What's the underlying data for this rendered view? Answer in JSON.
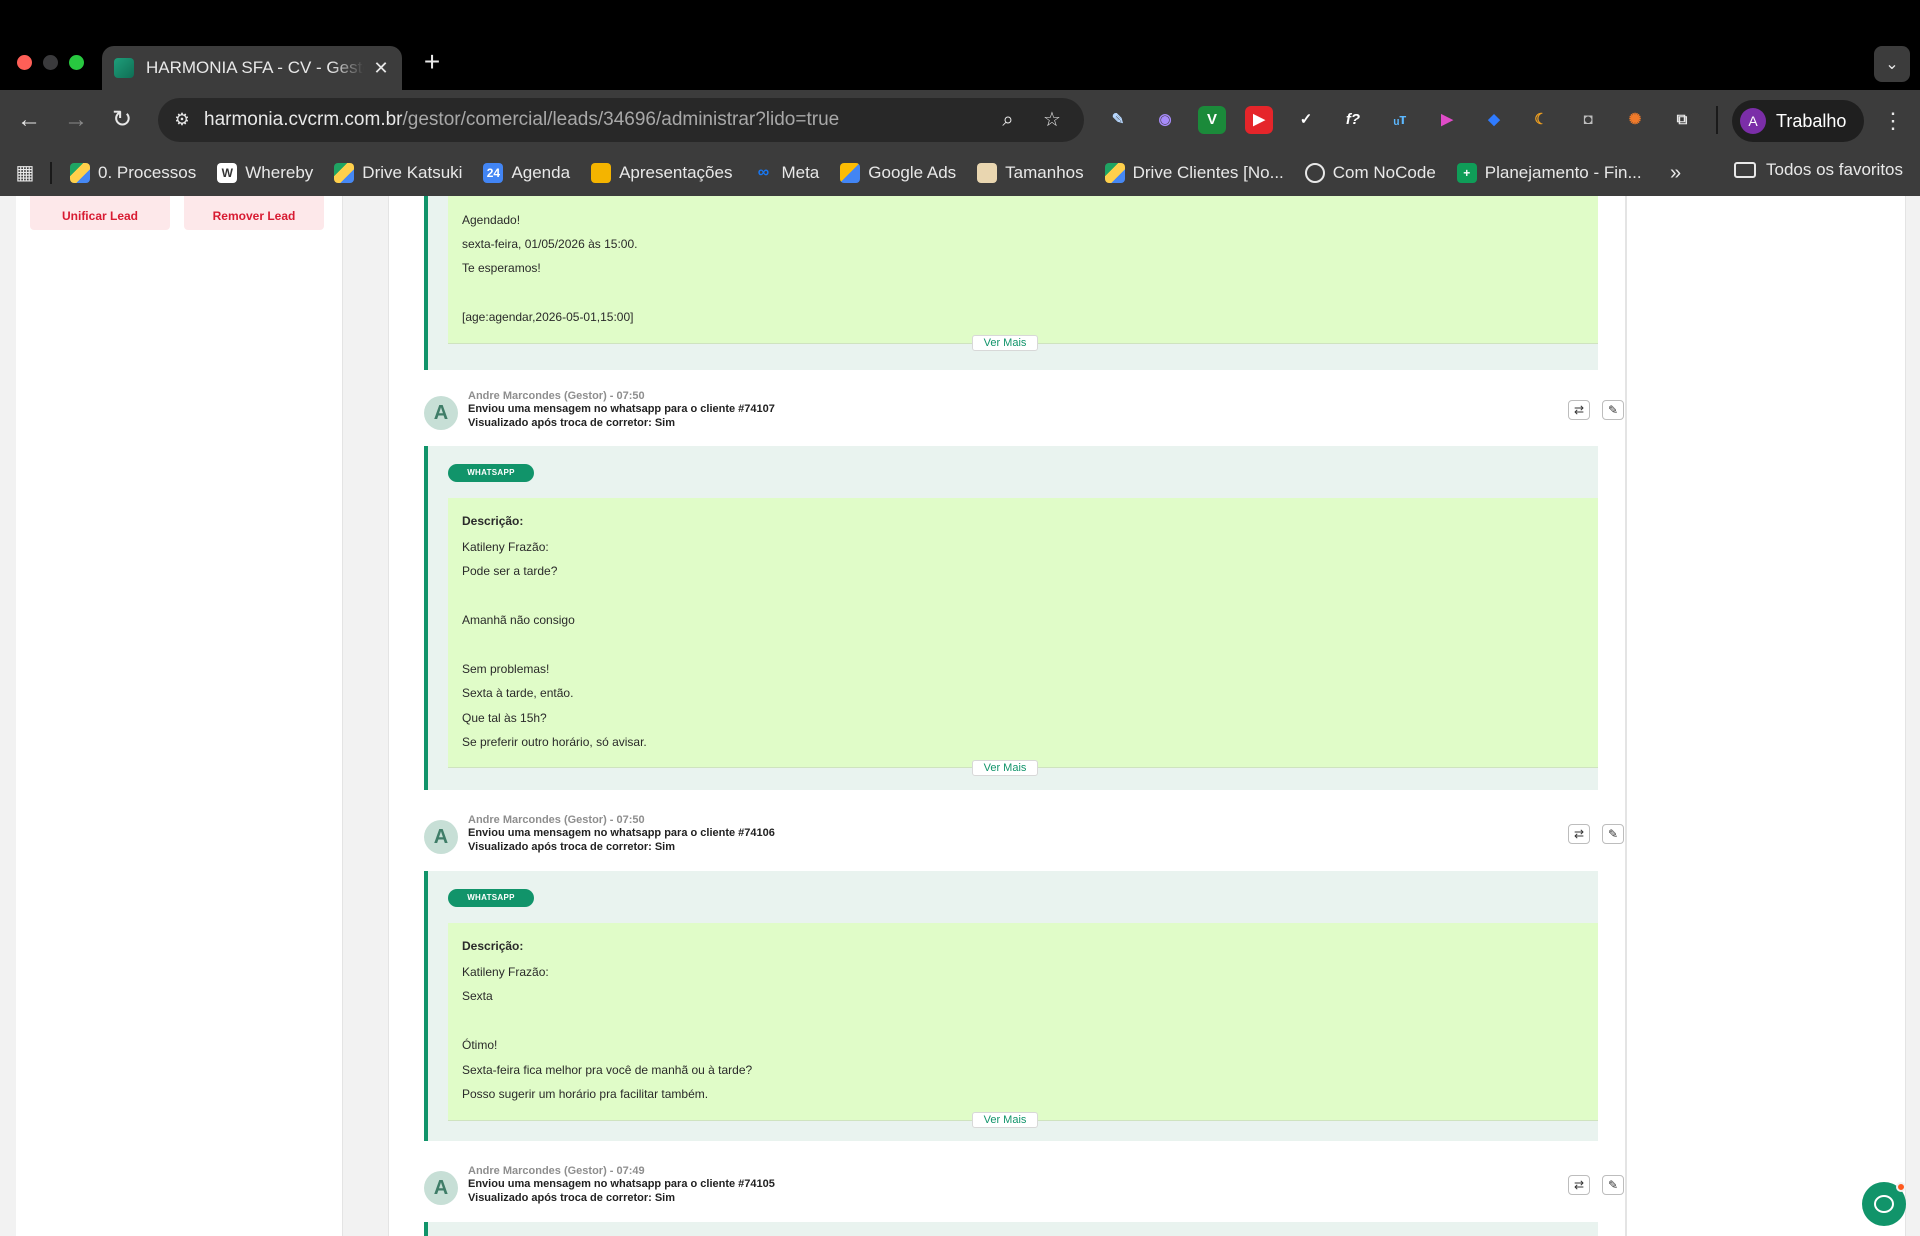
{
  "browser": {
    "tab_title": "HARMONIA SFA - CV - Gestor",
    "url_domain": "harmonia.cvcrm.com.br",
    "url_path": "/gestor/comercial/leads/34696/administrar?lido=true",
    "profile_initial": "A",
    "profile_name": "Trabalho",
    "bookmarks": [
      {
        "label": "0. Processos",
        "icon": "drive-icon"
      },
      {
        "label": "Whereby",
        "icon": "whereby-icon"
      },
      {
        "label": "Drive Katsuki",
        "icon": "drive-icon"
      },
      {
        "label": "Agenda",
        "icon": "calendar-icon"
      },
      {
        "label": "Apresentações",
        "icon": "slides-icon"
      },
      {
        "label": "Meta",
        "icon": "meta-icon"
      },
      {
        "label": "Google Ads",
        "icon": "google-ads-icon"
      },
      {
        "label": "Tamanhos",
        "icon": "tamanhos-icon"
      },
      {
        "label": "Drive Clientes [No...",
        "icon": "drive-icon"
      },
      {
        "label": "Com NoCode",
        "icon": "nocode-icon"
      },
      {
        "label": "Planejamento - Fin...",
        "icon": "sheets-icon"
      }
    ],
    "all_bookmarks": "Todos os favoritos"
  },
  "left_panel": {
    "unificar_label": "Unificar Lead",
    "remover_label": "Remover Lead"
  },
  "timeline": {
    "first_block": {
      "lines": [
        "Agendado!",
        "sexta-feira, 01/05/2026 às 15:00.",
        "Te esperamos!",
        "",
        "[age:agendar,2026-05-01,15:00]"
      ],
      "ver_mais": "Ver Mais"
    },
    "entries": [
      {
        "author": "Andre Marcondes (Gestor) - 07:50",
        "action": "Enviou uma mensagem no whatsapp para o cliente #74107",
        "viewed": "Visualizado após troca de corretor:  Sim",
        "badge": "WHATSAPP",
        "desc_label": "Descrição:",
        "lines": [
          "Katileny Frazão:",
          "Pode ser a tarde?",
          "",
          "Amanhã não consigo",
          "",
          "Sem problemas!",
          "Sexta à tarde, então.",
          "Que tal às 15h?",
          "Se preferir outro horário, só avisar."
        ],
        "ver_mais": "Ver Mais"
      },
      {
        "author": "Andre Marcondes (Gestor) - 07:50",
        "action": "Enviou uma mensagem no whatsapp para o cliente #74106",
        "viewed": "Visualizado após troca de corretor:  Sim",
        "badge": "WHATSAPP",
        "desc_label": "Descrição:",
        "lines": [
          "Katileny Frazão:",
          "Sexta",
          "",
          "Ótimo!",
          "Sexta-feira fica melhor pra você de manhã ou à tarde?",
          "Posso sugerir um horário pra facilitar também."
        ],
        "ver_mais": "Ver Mais"
      },
      {
        "author": "Andre Marcondes (Gestor) - 07:49",
        "action": "Enviou uma mensagem no whatsapp para o cliente #74105",
        "viewed": "Visualizado após troca de corretor:  Sim"
      }
    ],
    "avatar_initial": "A"
  },
  "colors": {
    "accent": "#11946a",
    "message_bg": "#e0fcc8",
    "block_bg": "#e9f3ef",
    "danger": "#d81b32"
  }
}
